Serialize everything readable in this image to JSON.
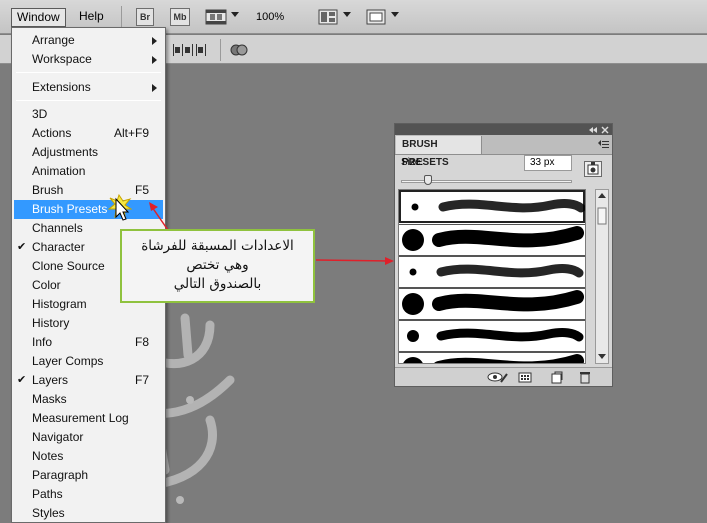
{
  "menubar": {
    "window_label": "Window",
    "help_label": "Help",
    "bridge_label": "Br",
    "minibridge_label": "Mb",
    "zoom_label": "100%"
  },
  "dropdown": {
    "items": [
      {
        "label": "Arrange",
        "submenu": true
      },
      {
        "label": "Workspace",
        "submenu": true
      },
      {
        "label": "Extensions",
        "submenu": true
      },
      {
        "label": "3D"
      },
      {
        "label": "Actions",
        "shortcut": "Alt+F9"
      },
      {
        "label": "Adjustments"
      },
      {
        "label": "Animation"
      },
      {
        "label": "Brush",
        "shortcut": "F5"
      },
      {
        "label": "Brush Presets",
        "highlighted": true
      },
      {
        "label": "Channels"
      },
      {
        "label": "Character",
        "checked": true
      },
      {
        "label": "Clone Source"
      },
      {
        "label": "Color"
      },
      {
        "label": "Histogram"
      },
      {
        "label": "History"
      },
      {
        "label": "Info",
        "shortcut": "F8"
      },
      {
        "label": "Layer Comps"
      },
      {
        "label": "Layers",
        "shortcut": "F7",
        "checked": true
      },
      {
        "label": "Masks"
      },
      {
        "label": "Measurement Log"
      },
      {
        "label": "Navigator"
      },
      {
        "label": "Notes"
      },
      {
        "label": "Paragraph"
      },
      {
        "label": "Paths"
      },
      {
        "label": "Styles"
      }
    ]
  },
  "callout": {
    "line1": "الاعدادات المسبقة للفرشاة",
    "line2": "وهي تختص",
    "line3": "بالصندوق التالي"
  },
  "panel": {
    "title": "BRUSH PRESETS",
    "size_label": "Size:",
    "size_value": "33 px"
  },
  "colors": {
    "highlight": "#3399ff",
    "callout_border": "#8fc23e",
    "arrow": "#e0202a"
  }
}
